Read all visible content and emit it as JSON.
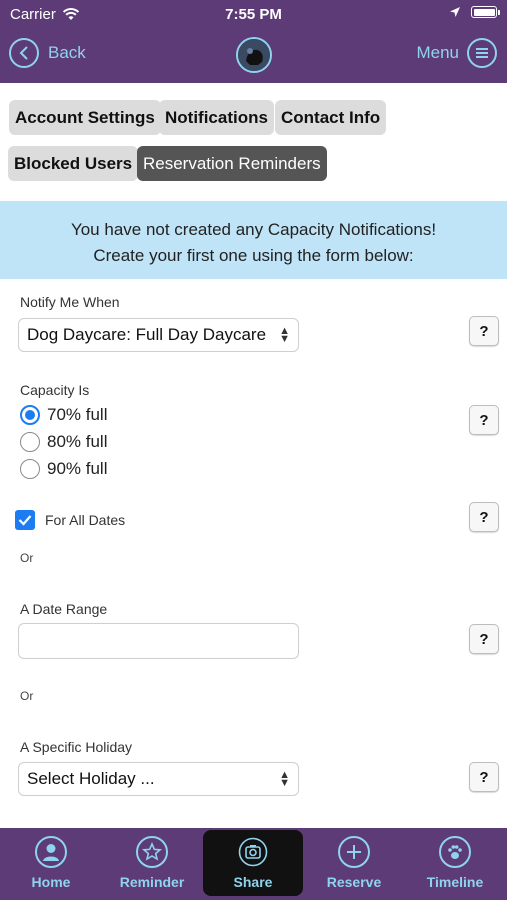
{
  "status_bar": {
    "carrier": "Carrier",
    "time": "7:55 PM"
  },
  "nav": {
    "back_label": "Back",
    "menu_label": "Menu"
  },
  "tabs": [
    {
      "label": "Account Settings",
      "active": false
    },
    {
      "label": "Notifications",
      "active": false
    },
    {
      "label": "Contact Info",
      "active": false
    },
    {
      "label": "Blocked Users",
      "active": false
    },
    {
      "label": "Reservation Reminders",
      "active": true
    }
  ],
  "banner": {
    "line1": "You have not created any Capacity Notifications!",
    "line2": "Create your first one using the form below:"
  },
  "form": {
    "notify_label": "Notify Me When",
    "notify_value": "Dog Daycare: Full Day Daycare",
    "capacity_label": "Capacity Is",
    "capacity_options": [
      {
        "label": "70% full",
        "selected": true
      },
      {
        "label": "80% full",
        "selected": false
      },
      {
        "label": "90% full",
        "selected": false
      }
    ],
    "all_dates_label": "For All Dates",
    "all_dates_checked": true,
    "or_text": "Or",
    "date_range_label": "A Date Range",
    "date_range_value": "",
    "holiday_label": "A Specific Holiday",
    "holiday_value": "Select Holiday ...",
    "help_label": "?"
  },
  "tabbar": [
    {
      "label": "Home",
      "icon": "person-icon"
    },
    {
      "label": "Reminder",
      "icon": "star-icon"
    },
    {
      "label": "Share",
      "icon": "camera-icon"
    },
    {
      "label": "Reserve",
      "icon": "plus-icon"
    },
    {
      "label": "Timeline",
      "icon": "paw-icon"
    }
  ],
  "colors": {
    "header_bg": "#5d3b76",
    "accent": "#8fd3ee",
    "banner_bg": "#bfe4f7",
    "active_tab_bg": "#555555",
    "checkbox_blue": "#1e7cf2"
  }
}
